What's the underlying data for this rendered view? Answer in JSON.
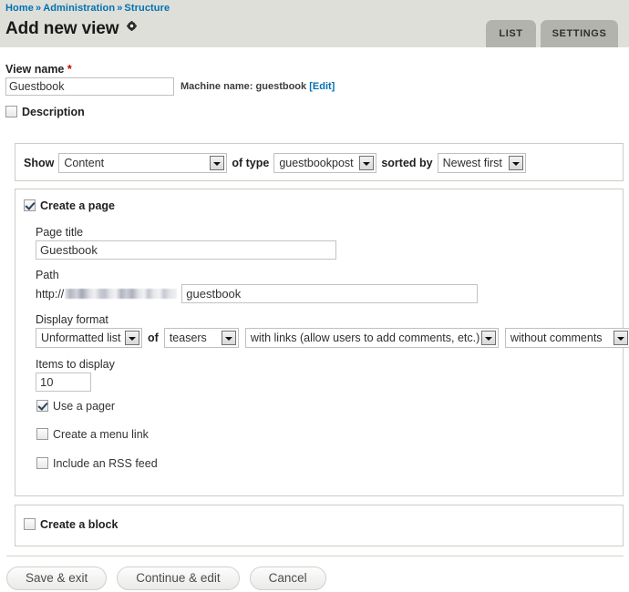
{
  "header": {
    "breadcrumb": [
      {
        "label": "Home"
      },
      {
        "label": "Administration"
      },
      {
        "label": "Structure"
      }
    ],
    "separator": "»",
    "title": "Add new view",
    "gear_icon": "gear-icon",
    "tabs": [
      {
        "label": "LIST",
        "active": false
      },
      {
        "label": "SETTINGS",
        "active": false
      }
    ]
  },
  "view_name": {
    "label": "View name",
    "required_marker": "*",
    "value": "Guestbook",
    "placeholder": "",
    "machine_name_prefix": "Machine name: ",
    "machine_name_value": "guestbook",
    "edit_link": "[Edit]"
  },
  "description": {
    "label": "Description",
    "checked": false
  },
  "show_panel": {
    "show_label": "Show",
    "show_value": "Content",
    "of_type_label": "of type",
    "of_type_value": "guestbookpost",
    "sorted_by_label": "sorted by",
    "sorted_by_value": "Newest first"
  },
  "create_page": {
    "label": "Create a page",
    "checked": true,
    "page_title_label": "Page title",
    "page_title_value": "Guestbook",
    "path_label": "Path",
    "path_protocol": "http://",
    "path_host_redacted": "",
    "path_value": "guestbook",
    "display_format_label": "Display format",
    "display_format_value": "Unformatted list",
    "display_format_of": "of",
    "display_row_value": "teasers",
    "display_links_value": "with links (allow users to add comments, etc.)",
    "display_comments_value": "without comments",
    "items_label": "Items to display",
    "items_value": "10",
    "use_pager_label": "Use a pager",
    "use_pager_checked": true,
    "menu_link_label": "Create a menu link",
    "menu_link_checked": false,
    "rss_label": "Include an RSS feed",
    "rss_checked": false
  },
  "create_block": {
    "label": "Create a block",
    "checked": false
  },
  "actions": {
    "save_exit": "Save & exit",
    "continue_edit": "Continue & edit",
    "cancel": "Cancel"
  },
  "colors": {
    "header_band": "#dedfd8",
    "tab_bg": "#b3b3ae",
    "link": "#0071b3",
    "required": "#cc0000",
    "panel_border": "#ccccc6"
  }
}
